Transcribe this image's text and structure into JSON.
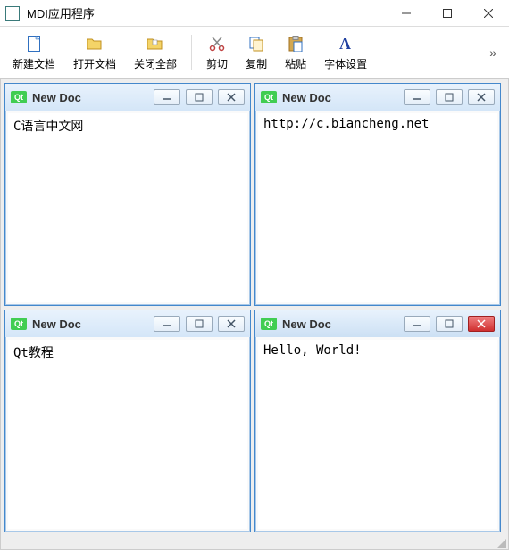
{
  "window": {
    "title": "MDI应用程序"
  },
  "toolbar": {
    "new_doc": "新建文档",
    "open_doc": "打开文档",
    "close_all": "关闭全部",
    "cut": "剪切",
    "copy": "复制",
    "paste": "粘贴",
    "font_settings": "字体设置"
  },
  "children": [
    {
      "title": "New Doc",
      "content": "C语言中文网"
    },
    {
      "title": "New Doc",
      "content": "http://c.biancheng.net"
    },
    {
      "title": "New Doc",
      "content": "Qt教程"
    },
    {
      "title": "New Doc",
      "content": "Hello, World!"
    }
  ],
  "qt_badge": "Qt"
}
